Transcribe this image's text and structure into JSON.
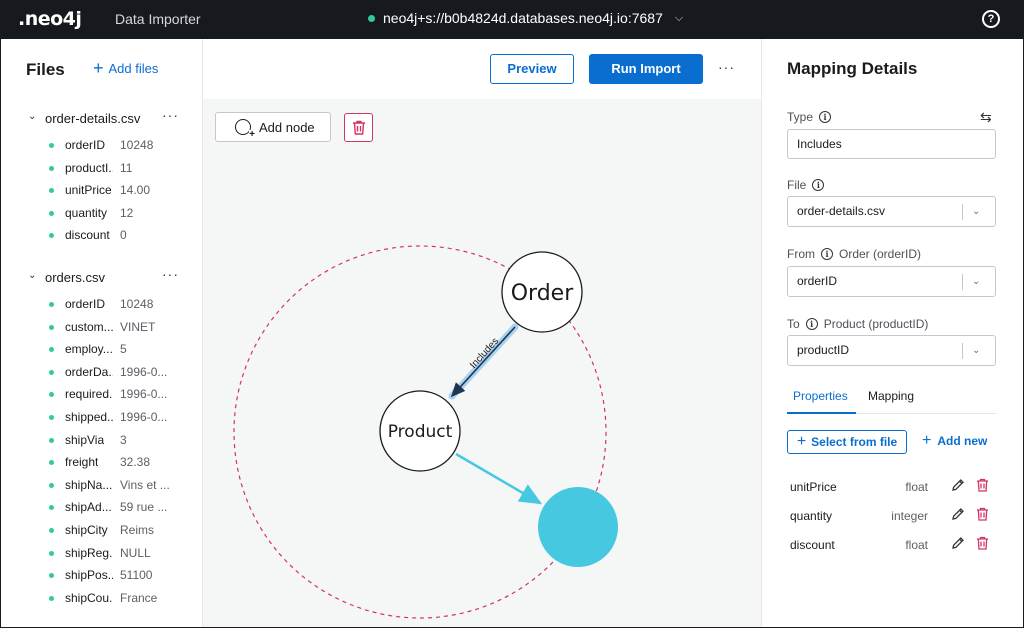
{
  "topbar": {
    "logo": ".neo4j",
    "app_title": "Data Importer",
    "db_uri": "neo4j+s://b0b4824d.databases.neo4j.io:7687",
    "db_status_color": "#36c79a"
  },
  "sidebar": {
    "title": "Files",
    "add_files_label": "Add files",
    "files": [
      {
        "name": "order-details.csv",
        "fields": [
          {
            "name": "orderID",
            "value": "10248"
          },
          {
            "name": "productI...",
            "value": "11"
          },
          {
            "name": "unitPrice",
            "value": "14.00"
          },
          {
            "name": "quantity",
            "value": "12"
          },
          {
            "name": "discount",
            "value": "0"
          }
        ]
      },
      {
        "name": "orders.csv",
        "fields": [
          {
            "name": "orderID",
            "value": "10248"
          },
          {
            "name": "custom...",
            "value": "VINET"
          },
          {
            "name": "employ...",
            "value": "5"
          },
          {
            "name": "orderDa...",
            "value": "1996-0..."
          },
          {
            "name": "required...",
            "value": "1996-0..."
          },
          {
            "name": "shipped...",
            "value": "1996-0..."
          },
          {
            "name": "shipVia",
            "value": "3"
          },
          {
            "name": "freight",
            "value": "32.38"
          },
          {
            "name": "shipNa...",
            "value": "Vins et ..."
          },
          {
            "name": "shipAd...",
            "value": "59 rue ..."
          },
          {
            "name": "shipCity",
            "value": "Reims"
          },
          {
            "name": "shipReg...",
            "value": "NULL"
          },
          {
            "name": "shipPos...",
            "value": "51100"
          },
          {
            "name": "shipCou...",
            "value": "France"
          }
        ]
      }
    ]
  },
  "toolbar": {
    "preview_label": "Preview",
    "run_import_label": "Run Import",
    "add_node_label": "Add node"
  },
  "graph": {
    "nodes": {
      "order": "Order",
      "product": "Product"
    },
    "relationship_label": "Includes",
    "accent_color": "#45c8e0",
    "selection_color": "#d43361"
  },
  "mapping": {
    "title": "Mapping Details",
    "type_label": "Type",
    "type_value": "Includes",
    "file_label": "File",
    "file_value": "order-details.csv",
    "from_label": "From",
    "from_node": "Order (orderID)",
    "from_value": "orderID",
    "to_label": "To",
    "to_node": "Product (productID)",
    "to_value": "productID",
    "tabs": [
      "Properties",
      "Mapping"
    ],
    "select_from_file_label": "Select from file",
    "add_new_label": "Add new",
    "properties": [
      {
        "name": "unitPrice",
        "type": "float"
      },
      {
        "name": "quantity",
        "type": "integer"
      },
      {
        "name": "discount",
        "type": "float"
      }
    ]
  }
}
